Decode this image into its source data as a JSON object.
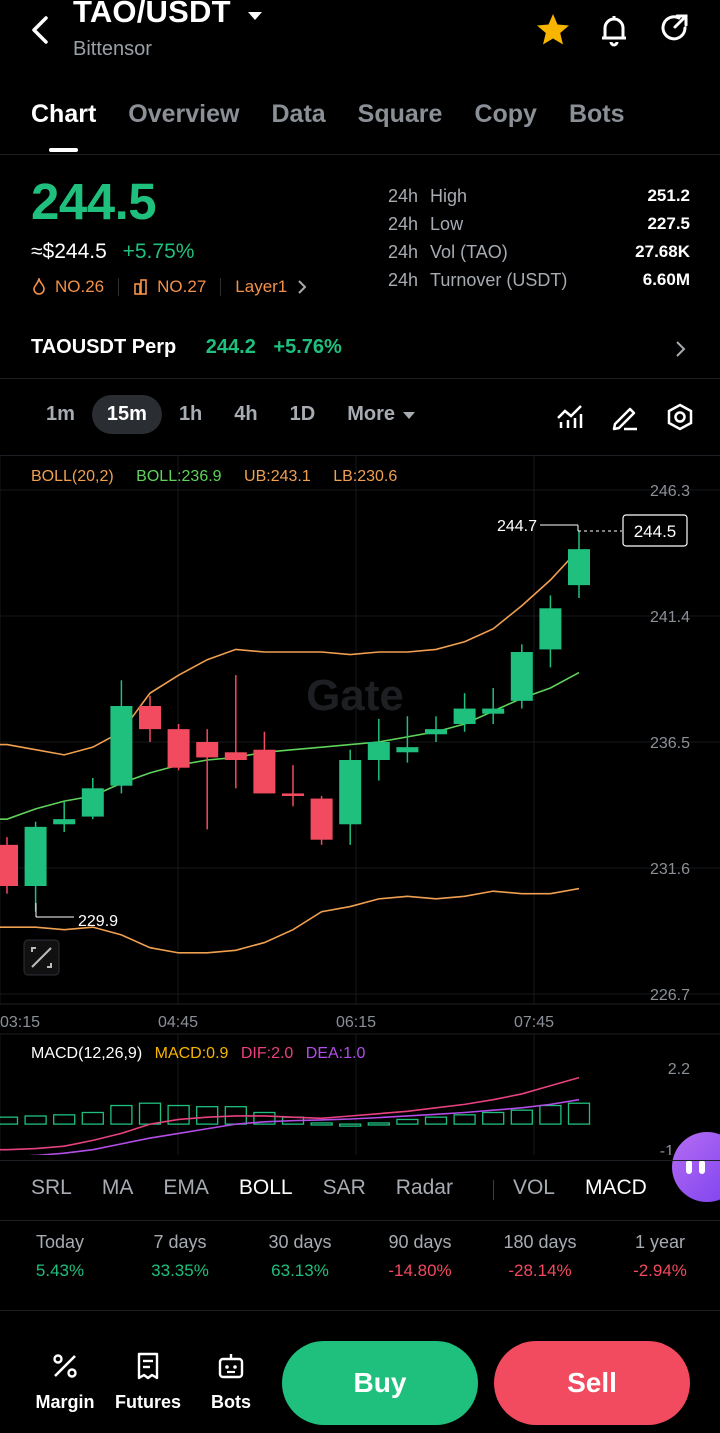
{
  "header": {
    "pair": "TAO/USDT",
    "subtitle": "Bittensor"
  },
  "tabs": [
    "Chart",
    "Overview",
    "Data",
    "Square",
    "Copy",
    "Bots"
  ],
  "price": {
    "last": "244.5",
    "usd": "≈$244.5",
    "change": "+5.75%",
    "rank1": "NO.26",
    "rank2": "NO.27",
    "tag": "Layer1"
  },
  "stats": [
    {
      "p": "24h",
      "k": "High",
      "v": "251.2"
    },
    {
      "p": "24h",
      "k": "Low",
      "v": "227.5"
    },
    {
      "p": "24h",
      "k": "Vol (TAO)",
      "v": "27.68K"
    },
    {
      "p": "24h",
      "k": "Turnover (USDT)",
      "v": "6.60M"
    }
  ],
  "perp": {
    "name": "TAOUSDT Perp",
    "price": "244.2",
    "change": "+5.76%"
  },
  "timeframes": [
    "1m",
    "15m",
    "1h",
    "4h",
    "1D",
    "More"
  ],
  "chart_data": {
    "type": "candlestick",
    "boll_legend": {
      "label": "BOLL(20,2)",
      "boll": "BOLL:236.9",
      "ub": "UB:243.1",
      "lb": "LB:230.6"
    },
    "y_ticks": [
      "246.3",
      "241.4",
      "236.5",
      "231.6",
      "226.7"
    ],
    "ylim": [
      226.7,
      246.3
    ],
    "x_ticks": [
      "03:15",
      "04:45",
      "06:15",
      "07:45"
    ],
    "high_label": "244.7",
    "low_label": "229.9",
    "last_label": "244.5",
    "candles": [
      {
        "o": 232.5,
        "c": 230.9,
        "h": 232.8,
        "l": 230.6
      },
      {
        "o": 230.9,
        "c": 233.2,
        "h": 233.4,
        "l": 229.9
      },
      {
        "o": 233.3,
        "c": 233.5,
        "h": 234.2,
        "l": 233.0
      },
      {
        "o": 233.6,
        "c": 234.7,
        "h": 235.1,
        "l": 233.5
      },
      {
        "o": 234.8,
        "c": 237.9,
        "h": 238.9,
        "l": 234.5
      },
      {
        "o": 237.9,
        "c": 237.0,
        "h": 238.3,
        "l": 236.5
      },
      {
        "o": 237.0,
        "c": 235.5,
        "h": 237.2,
        "l": 235.4
      },
      {
        "o": 236.5,
        "c": 235.9,
        "h": 237.0,
        "l": 233.1
      },
      {
        "o": 236.1,
        "c": 235.8,
        "h": 239.1,
        "l": 234.7
      },
      {
        "o": 236.2,
        "c": 234.5,
        "h": 236.9,
        "l": 234.5
      },
      {
        "o": 234.5,
        "c": 234.4,
        "h": 235.6,
        "l": 234.0
      },
      {
        "o": 234.3,
        "c": 232.7,
        "h": 234.4,
        "l": 232.5
      },
      {
        "o": 233.3,
        "c": 235.8,
        "h": 236.2,
        "l": 232.5
      },
      {
        "o": 235.8,
        "c": 236.5,
        "h": 237.4,
        "l": 235.0
      },
      {
        "o": 236.1,
        "c": 236.3,
        "h": 237.5,
        "l": 235.7
      },
      {
        "o": 236.8,
        "c": 237.0,
        "h": 237.5,
        "l": 236.5
      },
      {
        "o": 237.2,
        "c": 237.8,
        "h": 238.4,
        "l": 236.9
      },
      {
        "o": 237.6,
        "c": 237.8,
        "h": 238.6,
        "l": 237.2
      },
      {
        "o": 238.1,
        "c": 240.0,
        "h": 240.3,
        "l": 237.8
      },
      {
        "o": 240.1,
        "c": 241.7,
        "h": 242.2,
        "l": 239.4
      },
      {
        "o": 242.6,
        "c": 244.0,
        "h": 244.7,
        "l": 242.1
      }
    ],
    "boll_mid": [
      233.5,
      233.9,
      234.2,
      234.4,
      234.9,
      235.3,
      235.6,
      235.8,
      235.9,
      236.1,
      236.2,
      236.3,
      236.4,
      236.5,
      236.7,
      236.9,
      237.2,
      237.7,
      238.2,
      238.6,
      239.2
    ],
    "boll_upper": [
      236.4,
      236.2,
      236.0,
      236.3,
      236.9,
      238.4,
      239.1,
      239.7,
      240.1,
      240.0,
      240.0,
      240.0,
      239.9,
      240.0,
      240.0,
      240.1,
      240.4,
      240.9,
      241.8,
      242.8,
      244.0
    ],
    "boll_lower": [
      229.3,
      229.3,
      229.2,
      229.3,
      229.0,
      228.5,
      228.3,
      228.3,
      228.4,
      228.7,
      229.2,
      229.9,
      230.1,
      230.4,
      230.5,
      230.4,
      230.5,
      230.7,
      230.6,
      230.6,
      230.8
    ],
    "macd_legend": {
      "label": "MACD(12,26,9)",
      "macd": "MACD:0.9",
      "dif": "DIF:2.0",
      "dea": "DEA:1.0"
    },
    "macd_ylabels": [
      "2.2",
      "-1"
    ],
    "macd_hist": [
      0.3,
      0.35,
      0.4,
      0.5,
      0.8,
      0.9,
      0.8,
      0.75,
      0.75,
      0.5,
      0.3,
      0.05,
      0.0,
      0.05,
      0.2,
      0.3,
      0.4,
      0.5,
      0.6,
      0.8,
      0.9
    ],
    "dif": [
      -1.1,
      -1.05,
      -0.95,
      -0.7,
      -0.4,
      0.0,
      0.2,
      0.3,
      0.35,
      0.35,
      0.3,
      0.25,
      0.35,
      0.45,
      0.55,
      0.7,
      0.85,
      1.05,
      1.3,
      1.65,
      2.0
    ],
    "dea": [
      -1.4,
      -1.35,
      -1.25,
      -1.1,
      -0.85,
      -0.6,
      -0.4,
      -0.2,
      0.0,
      0.1,
      0.15,
      0.18,
      0.22,
      0.28,
      0.35,
      0.42,
      0.5,
      0.6,
      0.7,
      0.85,
      1.05
    ]
  },
  "indicators": [
    "SRL",
    "MA",
    "EMA",
    "BOLL",
    "SAR",
    "Radar",
    "VOL",
    "MACD"
  ],
  "performance": [
    {
      "label": "Today",
      "value": "5.43%",
      "dir": "up"
    },
    {
      "label": "7 days",
      "value": "33.35%",
      "dir": "up"
    },
    {
      "label": "30 days",
      "value": "63.13%",
      "dir": "up"
    },
    {
      "label": "90 days",
      "value": "-14.80%",
      "dir": "dn"
    },
    {
      "label": "180 days",
      "value": "-28.14%",
      "dir": "dn"
    },
    {
      "label": "1 year",
      "value": "-2.94%",
      "dir": "dn"
    }
  ],
  "bottom": {
    "margin": "Margin",
    "futures": "Futures",
    "bots": "Bots",
    "buy": "Buy",
    "sell": "Sell"
  },
  "colors": {
    "up": "#1fbf7e",
    "down": "#f24a5f",
    "ub": "#f0a050",
    "mid": "#5fd35a",
    "dif": "#e8417f",
    "dea": "#b24ee6"
  }
}
